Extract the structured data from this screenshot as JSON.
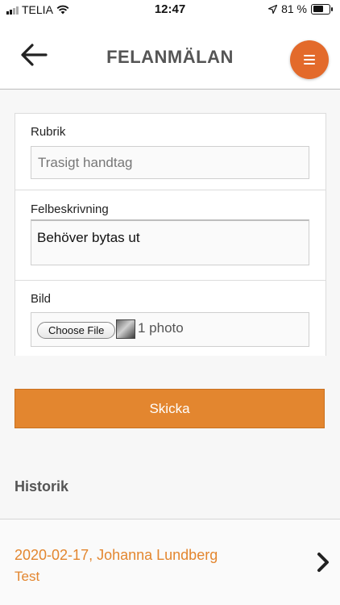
{
  "status_bar": {
    "carrier": "TELIA",
    "time": "12:47",
    "battery_text": "81 %",
    "battery_level_percent": 81
  },
  "header": {
    "title": "FELANMÄLAN",
    "back_icon": "arrow-left-icon",
    "menu_icon": "hamburger-menu-icon",
    "accent_color": "#e36a2b"
  },
  "form": {
    "rubrik": {
      "label": "Rubrik",
      "value": "Trasigt handtag"
    },
    "description": {
      "label": "Felbeskrivning",
      "value": "Behöver bytas ut"
    },
    "image": {
      "label": "Bild",
      "choose_label": "Choose File",
      "file_status": "1 photo"
    }
  },
  "submit": {
    "label": "Skicka",
    "color": "#e3862f"
  },
  "history": {
    "title": "Historik",
    "items": [
      {
        "line1": "2020-02-17, Johanna Lundberg",
        "line2": "Test"
      }
    ]
  }
}
